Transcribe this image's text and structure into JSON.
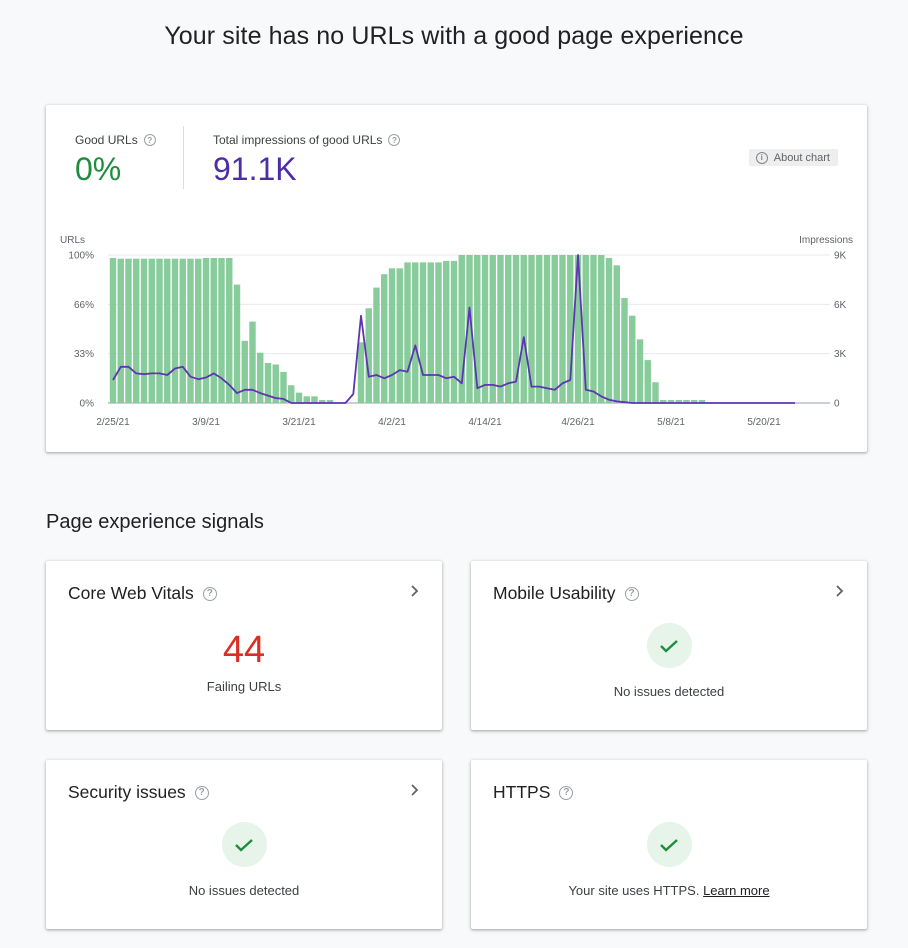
{
  "page": {
    "title": "Your site has no URLs with a good page experience"
  },
  "summary": {
    "good_urls_label": "Good URLs",
    "good_urls_value": "0%",
    "impressions_label": "Total impressions of good URLs",
    "impressions_value": "91.1K",
    "about_chart_label": "About chart",
    "colors": {
      "good": "#1e8e3e",
      "impressions": "#4c2fa7"
    }
  },
  "chart_data": {
    "type": "bar+line",
    "title": "",
    "left_axis": {
      "label": "URLs",
      "ticks": [
        "0%",
        "33%",
        "66%",
        "100%"
      ],
      "range": [
        0,
        100
      ]
    },
    "right_axis": {
      "label": "Impressions",
      "ticks": [
        "0",
        "3K",
        "6K",
        "9K"
      ],
      "range": [
        0,
        9000
      ]
    },
    "x_tick_labels": [
      "2/25/21",
      "3/9/21",
      "3/21/21",
      "4/2/21",
      "4/14/21",
      "4/26/21",
      "5/8/21",
      "5/20/21"
    ],
    "x_start": "2/25/21",
    "x_step_days": 1,
    "grid": true,
    "legend": "none",
    "series": [
      {
        "name": "Good URLs (%)",
        "type": "bar",
        "axis": "left",
        "color": "#81c995",
        "values": [
          98,
          97.5,
          97.5,
          97.5,
          97.5,
          97.5,
          97.5,
          97.5,
          97.5,
          97.5,
          97.5,
          97.5,
          98,
          98,
          98,
          98,
          80,
          42,
          55,
          34,
          27,
          26,
          21,
          12,
          7,
          4.5,
          4.5,
          2,
          2,
          0,
          0,
          0,
          41,
          64,
          78,
          87,
          91,
          91,
          95,
          95,
          95,
          95,
          95,
          96,
          96,
          100,
          100,
          100,
          100,
          100,
          100,
          100,
          100,
          100,
          100,
          100,
          100,
          100,
          100,
          100,
          100,
          100,
          100,
          100,
          98,
          93,
          71,
          59,
          43,
          29,
          14,
          2,
          2,
          2,
          2,
          2,
          2,
          0,
          0,
          0,
          0,
          0,
          0,
          0,
          0,
          0,
          0,
          0,
          0
        ]
      },
      {
        "name": "Impressions",
        "type": "line",
        "axis": "right",
        "color": "#5e35b1",
        "values": [
          1400,
          2200,
          2200,
          1800,
          1750,
          1800,
          1800,
          1700,
          2100,
          2200,
          1600,
          1450,
          1550,
          1800,
          1500,
          1100,
          600,
          800,
          800,
          600,
          450,
          300,
          250,
          0,
          0,
          0,
          0,
          0,
          0,
          0,
          0,
          550,
          5300,
          1600,
          1700,
          1500,
          1700,
          2000,
          1900,
          3500,
          1700,
          1700,
          1700,
          1500,
          1600,
          1200,
          5800,
          900,
          1100,
          1100,
          1000,
          1200,
          1300,
          4000,
          1000,
          1000,
          900,
          800,
          1200,
          1400,
          9000,
          800,
          700,
          400,
          200,
          100,
          50,
          0,
          0,
          0,
          0,
          0,
          0,
          0,
          0,
          0,
          0,
          0,
          0,
          0,
          0,
          0,
          0,
          0,
          0,
          0,
          0,
          0,
          0
        ]
      }
    ]
  },
  "section": {
    "title": "Page experience signals"
  },
  "signals": [
    {
      "title": "Core Web Vitals",
      "value": "44",
      "value_color": "#d93025",
      "subtitle": "Failing URLs",
      "has_chevron": true
    },
    {
      "title": "Mobile Usability",
      "status": "ok",
      "subtitle": "No issues detected",
      "has_chevron": true
    },
    {
      "title": "Security issues",
      "status": "ok",
      "subtitle": "No issues detected",
      "has_chevron": true
    },
    {
      "title": "HTTPS",
      "status": "ok",
      "subtitle": "Your site uses HTTPS.",
      "link": "Learn more",
      "has_chevron": false
    }
  ]
}
